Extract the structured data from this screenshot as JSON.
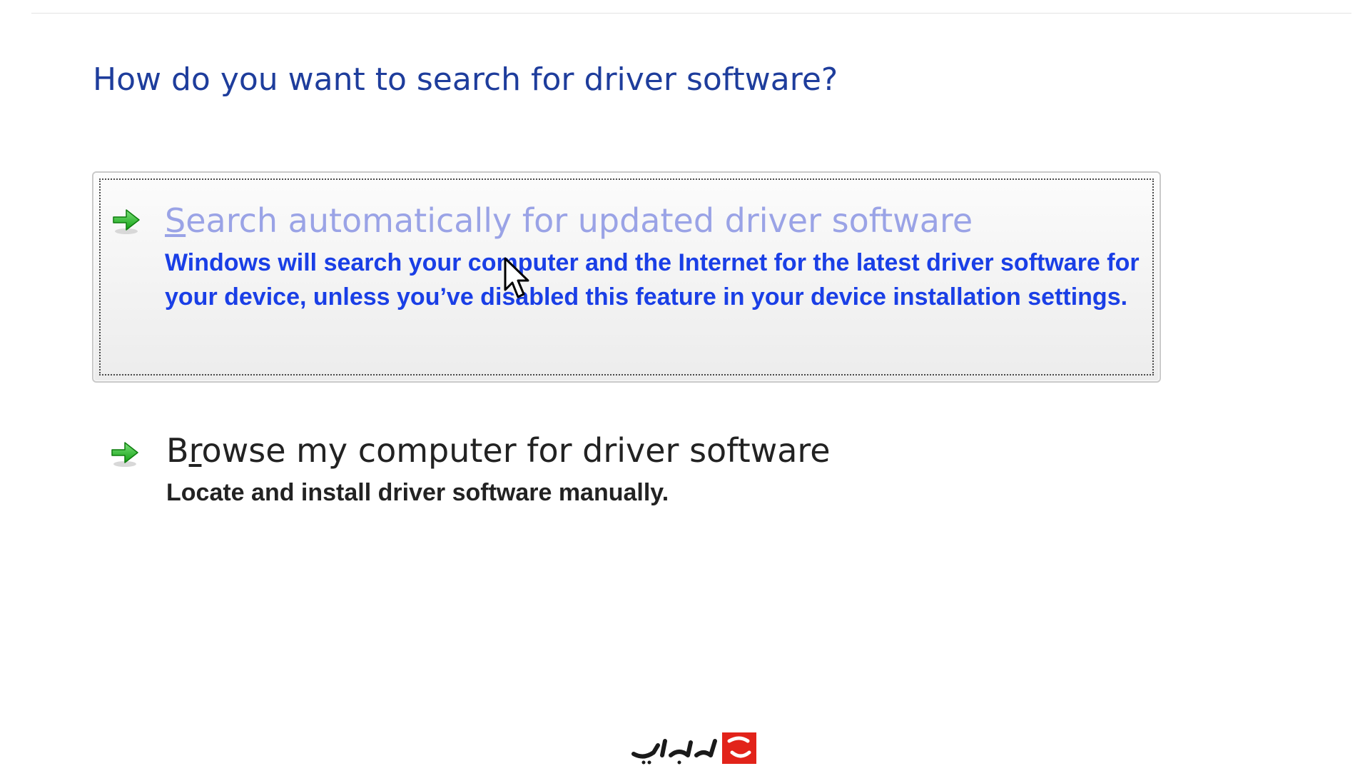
{
  "heading": "How do you want to search for driver software?",
  "options": [
    {
      "title_prefix": "",
      "title_accel": "S",
      "title_rest": "earch automatically for updated driver software",
      "description": "Windows will search your computer and the Internet for the latest driver software for your device, unless you’ve disabled this feature in your device installation settings.",
      "icon": "green-arrow-icon",
      "state": "hover-focused"
    },
    {
      "title_prefix": "B",
      "title_accel": "r",
      "title_rest": "owse my computer for driver software",
      "description": "Locate and install driver software manually.",
      "icon": "green-arrow-icon",
      "state": "normal"
    }
  ],
  "colors": {
    "heading": "#1e3d9c",
    "hover_title": "#9aa3e6",
    "hover_desc": "#1a3fe6",
    "normal_text": "#222222",
    "arrow_green": "#2bb52b",
    "watermark_red": "#e2231a"
  },
  "watermark": {
    "text": "دنیای بازی"
  }
}
